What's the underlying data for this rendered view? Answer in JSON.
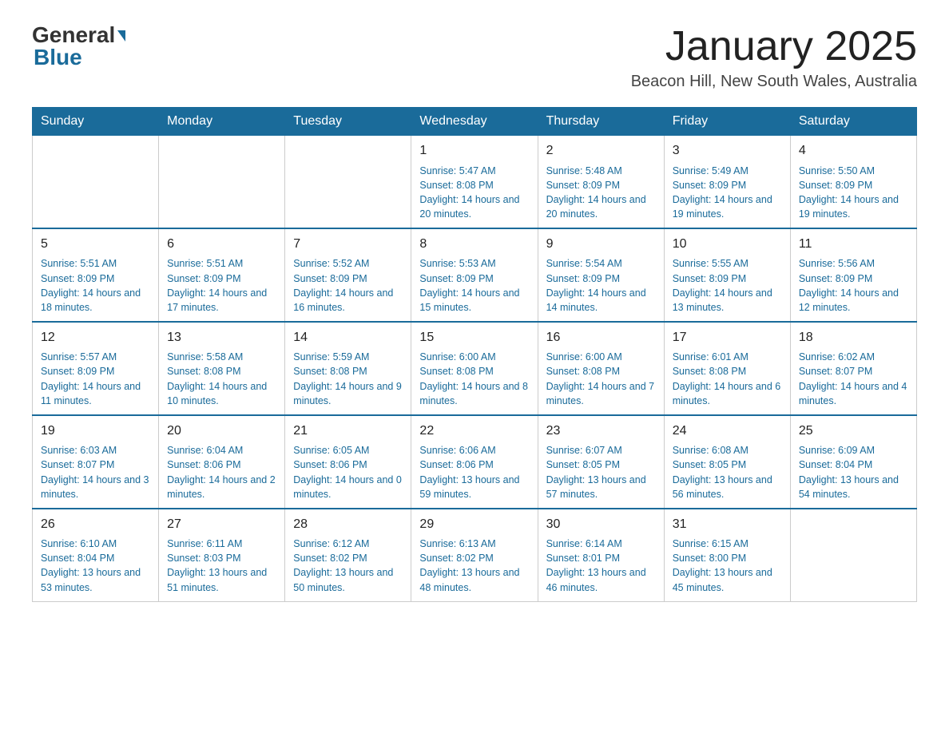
{
  "logo": {
    "general": "General",
    "blue": "Blue"
  },
  "title": "January 2025",
  "subtitle": "Beacon Hill, New South Wales, Australia",
  "days_of_week": [
    "Sunday",
    "Monday",
    "Tuesday",
    "Wednesday",
    "Thursday",
    "Friday",
    "Saturday"
  ],
  "weeks": [
    [
      {
        "day": "",
        "info": ""
      },
      {
        "day": "",
        "info": ""
      },
      {
        "day": "",
        "info": ""
      },
      {
        "day": "1",
        "info": "Sunrise: 5:47 AM\nSunset: 8:08 PM\nDaylight: 14 hours\nand 20 minutes."
      },
      {
        "day": "2",
        "info": "Sunrise: 5:48 AM\nSunset: 8:09 PM\nDaylight: 14 hours\nand 20 minutes."
      },
      {
        "day": "3",
        "info": "Sunrise: 5:49 AM\nSunset: 8:09 PM\nDaylight: 14 hours\nand 19 minutes."
      },
      {
        "day": "4",
        "info": "Sunrise: 5:50 AM\nSunset: 8:09 PM\nDaylight: 14 hours\nand 19 minutes."
      }
    ],
    [
      {
        "day": "5",
        "info": "Sunrise: 5:51 AM\nSunset: 8:09 PM\nDaylight: 14 hours\nand 18 minutes."
      },
      {
        "day": "6",
        "info": "Sunrise: 5:51 AM\nSunset: 8:09 PM\nDaylight: 14 hours\nand 17 minutes."
      },
      {
        "day": "7",
        "info": "Sunrise: 5:52 AM\nSunset: 8:09 PM\nDaylight: 14 hours\nand 16 minutes."
      },
      {
        "day": "8",
        "info": "Sunrise: 5:53 AM\nSunset: 8:09 PM\nDaylight: 14 hours\nand 15 minutes."
      },
      {
        "day": "9",
        "info": "Sunrise: 5:54 AM\nSunset: 8:09 PM\nDaylight: 14 hours\nand 14 minutes."
      },
      {
        "day": "10",
        "info": "Sunrise: 5:55 AM\nSunset: 8:09 PM\nDaylight: 14 hours\nand 13 minutes."
      },
      {
        "day": "11",
        "info": "Sunrise: 5:56 AM\nSunset: 8:09 PM\nDaylight: 14 hours\nand 12 minutes."
      }
    ],
    [
      {
        "day": "12",
        "info": "Sunrise: 5:57 AM\nSunset: 8:09 PM\nDaylight: 14 hours\nand 11 minutes."
      },
      {
        "day": "13",
        "info": "Sunrise: 5:58 AM\nSunset: 8:08 PM\nDaylight: 14 hours\nand 10 minutes."
      },
      {
        "day": "14",
        "info": "Sunrise: 5:59 AM\nSunset: 8:08 PM\nDaylight: 14 hours\nand 9 minutes."
      },
      {
        "day": "15",
        "info": "Sunrise: 6:00 AM\nSunset: 8:08 PM\nDaylight: 14 hours\nand 8 minutes."
      },
      {
        "day": "16",
        "info": "Sunrise: 6:00 AM\nSunset: 8:08 PM\nDaylight: 14 hours\nand 7 minutes."
      },
      {
        "day": "17",
        "info": "Sunrise: 6:01 AM\nSunset: 8:08 PM\nDaylight: 14 hours\nand 6 minutes."
      },
      {
        "day": "18",
        "info": "Sunrise: 6:02 AM\nSunset: 8:07 PM\nDaylight: 14 hours\nand 4 minutes."
      }
    ],
    [
      {
        "day": "19",
        "info": "Sunrise: 6:03 AM\nSunset: 8:07 PM\nDaylight: 14 hours\nand 3 minutes."
      },
      {
        "day": "20",
        "info": "Sunrise: 6:04 AM\nSunset: 8:06 PM\nDaylight: 14 hours\nand 2 minutes."
      },
      {
        "day": "21",
        "info": "Sunrise: 6:05 AM\nSunset: 8:06 PM\nDaylight: 14 hours\nand 0 minutes."
      },
      {
        "day": "22",
        "info": "Sunrise: 6:06 AM\nSunset: 8:06 PM\nDaylight: 13 hours\nand 59 minutes."
      },
      {
        "day": "23",
        "info": "Sunrise: 6:07 AM\nSunset: 8:05 PM\nDaylight: 13 hours\nand 57 minutes."
      },
      {
        "day": "24",
        "info": "Sunrise: 6:08 AM\nSunset: 8:05 PM\nDaylight: 13 hours\nand 56 minutes."
      },
      {
        "day": "25",
        "info": "Sunrise: 6:09 AM\nSunset: 8:04 PM\nDaylight: 13 hours\nand 54 minutes."
      }
    ],
    [
      {
        "day": "26",
        "info": "Sunrise: 6:10 AM\nSunset: 8:04 PM\nDaylight: 13 hours\nand 53 minutes."
      },
      {
        "day": "27",
        "info": "Sunrise: 6:11 AM\nSunset: 8:03 PM\nDaylight: 13 hours\nand 51 minutes."
      },
      {
        "day": "28",
        "info": "Sunrise: 6:12 AM\nSunset: 8:02 PM\nDaylight: 13 hours\nand 50 minutes."
      },
      {
        "day": "29",
        "info": "Sunrise: 6:13 AM\nSunset: 8:02 PM\nDaylight: 13 hours\nand 48 minutes."
      },
      {
        "day": "30",
        "info": "Sunrise: 6:14 AM\nSunset: 8:01 PM\nDaylight: 13 hours\nand 46 minutes."
      },
      {
        "day": "31",
        "info": "Sunrise: 6:15 AM\nSunset: 8:00 PM\nDaylight: 13 hours\nand 45 minutes."
      },
      {
        "day": "",
        "info": ""
      }
    ]
  ]
}
